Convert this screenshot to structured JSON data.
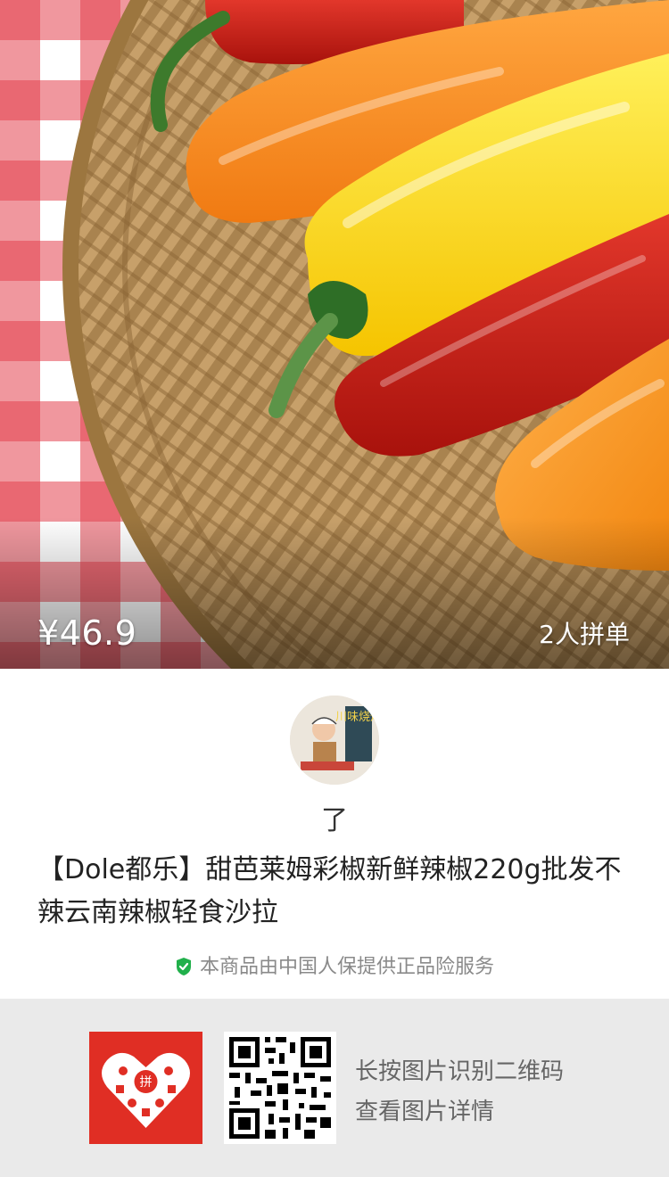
{
  "product_image": {
    "alt": ""
  },
  "price": "¥46.9",
  "group_buy": "2人拼单",
  "seller": {
    "nickname": "了",
    "avatar_text": "川味烧烤"
  },
  "product_title": "【Dole都乐】甜芭莱姆彩椒新鲜辣椒220g批发不辣云南辣椒轻食沙拉",
  "guarantee": {
    "icon": "shield-check-icon",
    "text": "本商品由中国人保提供正品险服务",
    "color": "#21b04b"
  },
  "footer": {
    "logo_icon": "pinduoduo-logo-icon",
    "logo_text": "拼",
    "qr_icon": "qr-code-icon",
    "hint_line1": "长按图片识别二维码",
    "hint_line2": "查看图片详情"
  },
  "colors": {
    "brand_red": "#e02e24",
    "footer_bg": "#eaeaea"
  }
}
